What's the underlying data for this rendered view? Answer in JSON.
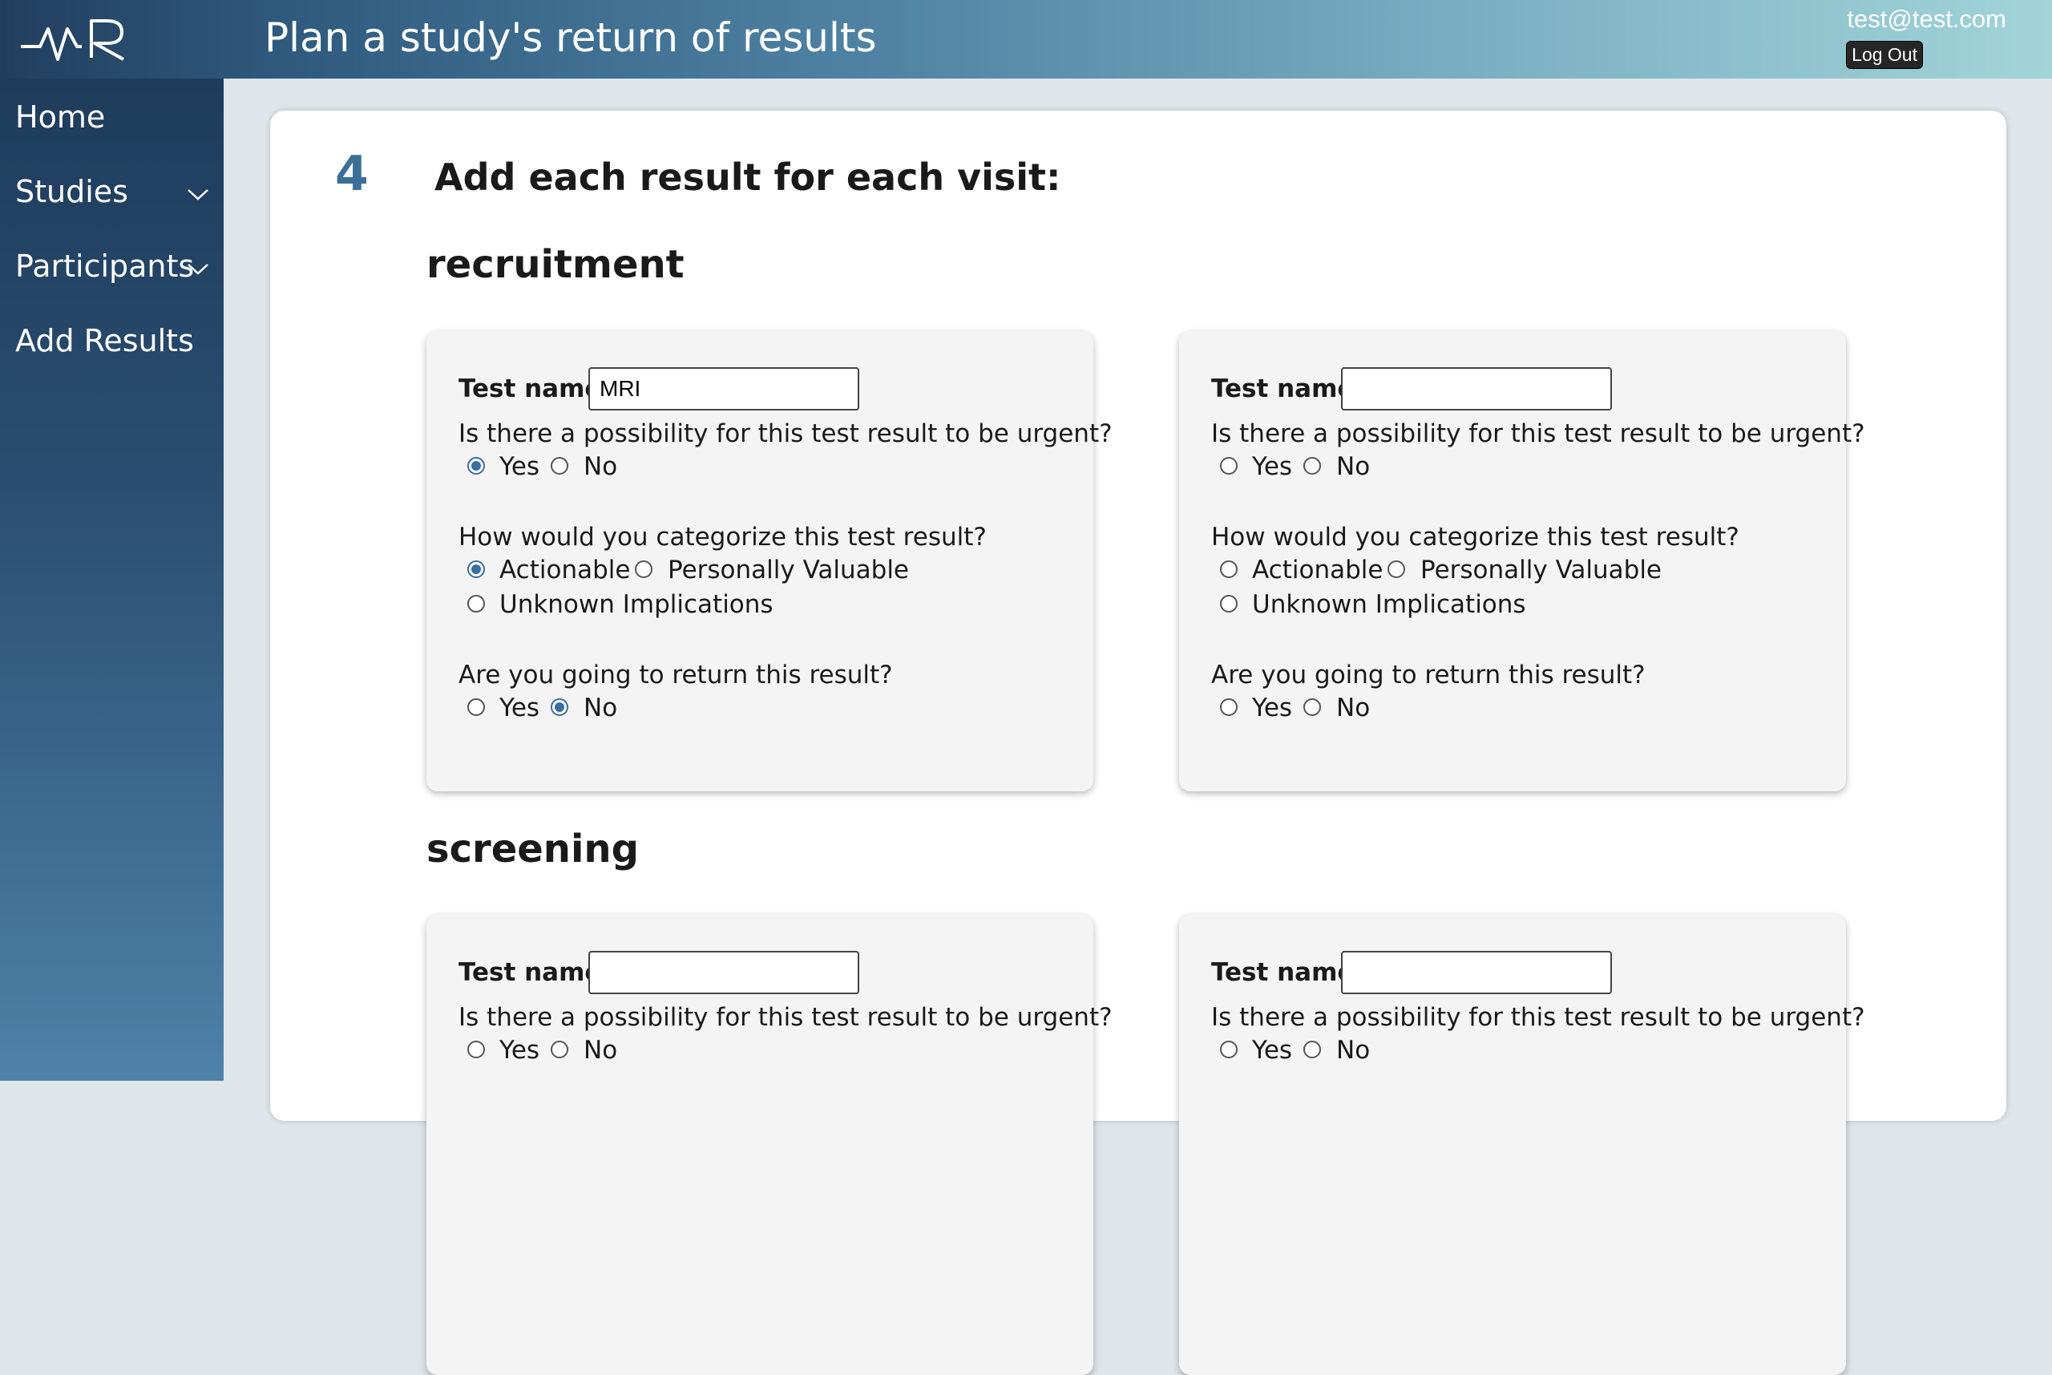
{
  "header": {
    "title": "Plan a study's return of results",
    "user_email": "test@test.com",
    "logout_label": "Log Out"
  },
  "sidebar": {
    "items": [
      {
        "label": "Home"
      },
      {
        "label": "Studies"
      },
      {
        "label": "Participants"
      },
      {
        "label": "Add Results"
      }
    ]
  },
  "main": {
    "step_number": "4",
    "step_title": "Add each result for each visit:",
    "visits": [
      {
        "name": "recruitment",
        "cards": [
          {
            "test_name_label": "Test name:",
            "test_name_value": "MRI",
            "urgent_question": "Is there a possibility for this test result to be urgent?",
            "urgent_yes": "Yes",
            "urgent_no": "No",
            "urgent_selected": "Yes",
            "category_question": "How would you categorize this test result?",
            "cat_actionable": "Actionable",
            "cat_personal": "Personally Valuable",
            "cat_unknown": "Unknown Implications",
            "category_selected": "Actionable",
            "return_question": "Are you going to return this result?",
            "return_yes": "Yes",
            "return_no": "No",
            "return_selected": "No"
          },
          {
            "test_name_label": "Test name:",
            "test_name_value": "",
            "urgent_question": "Is there a possibility for this test result to be urgent?",
            "urgent_yes": "Yes",
            "urgent_no": "No",
            "urgent_selected": "",
            "category_question": "How would you categorize this test result?",
            "cat_actionable": "Actionable",
            "cat_personal": "Personally Valuable",
            "cat_unknown": "Unknown Implications",
            "category_selected": "",
            "return_question": "Are you going to return this result?",
            "return_yes": "Yes",
            "return_no": "No",
            "return_selected": ""
          }
        ]
      },
      {
        "name": "screening",
        "cards": [
          {
            "test_name_label": "Test name:",
            "test_name_value": "",
            "urgent_question": "Is there a possibility for this test result to be urgent?",
            "urgent_yes": "Yes",
            "urgent_no": "No",
            "urgent_selected": ""
          },
          {
            "test_name_label": "Test name:",
            "test_name_value": "",
            "urgent_question": "Is there a possibility for this test result to be urgent?",
            "urgent_yes": "Yes",
            "urgent_no": "No",
            "urgent_selected": ""
          }
        ]
      }
    ]
  },
  "colors": {
    "accent": "#3a6ea0",
    "step_number": "#3c6f96",
    "sidebar_top": "#1f3c5c",
    "header_right": "#a2d4d8"
  }
}
